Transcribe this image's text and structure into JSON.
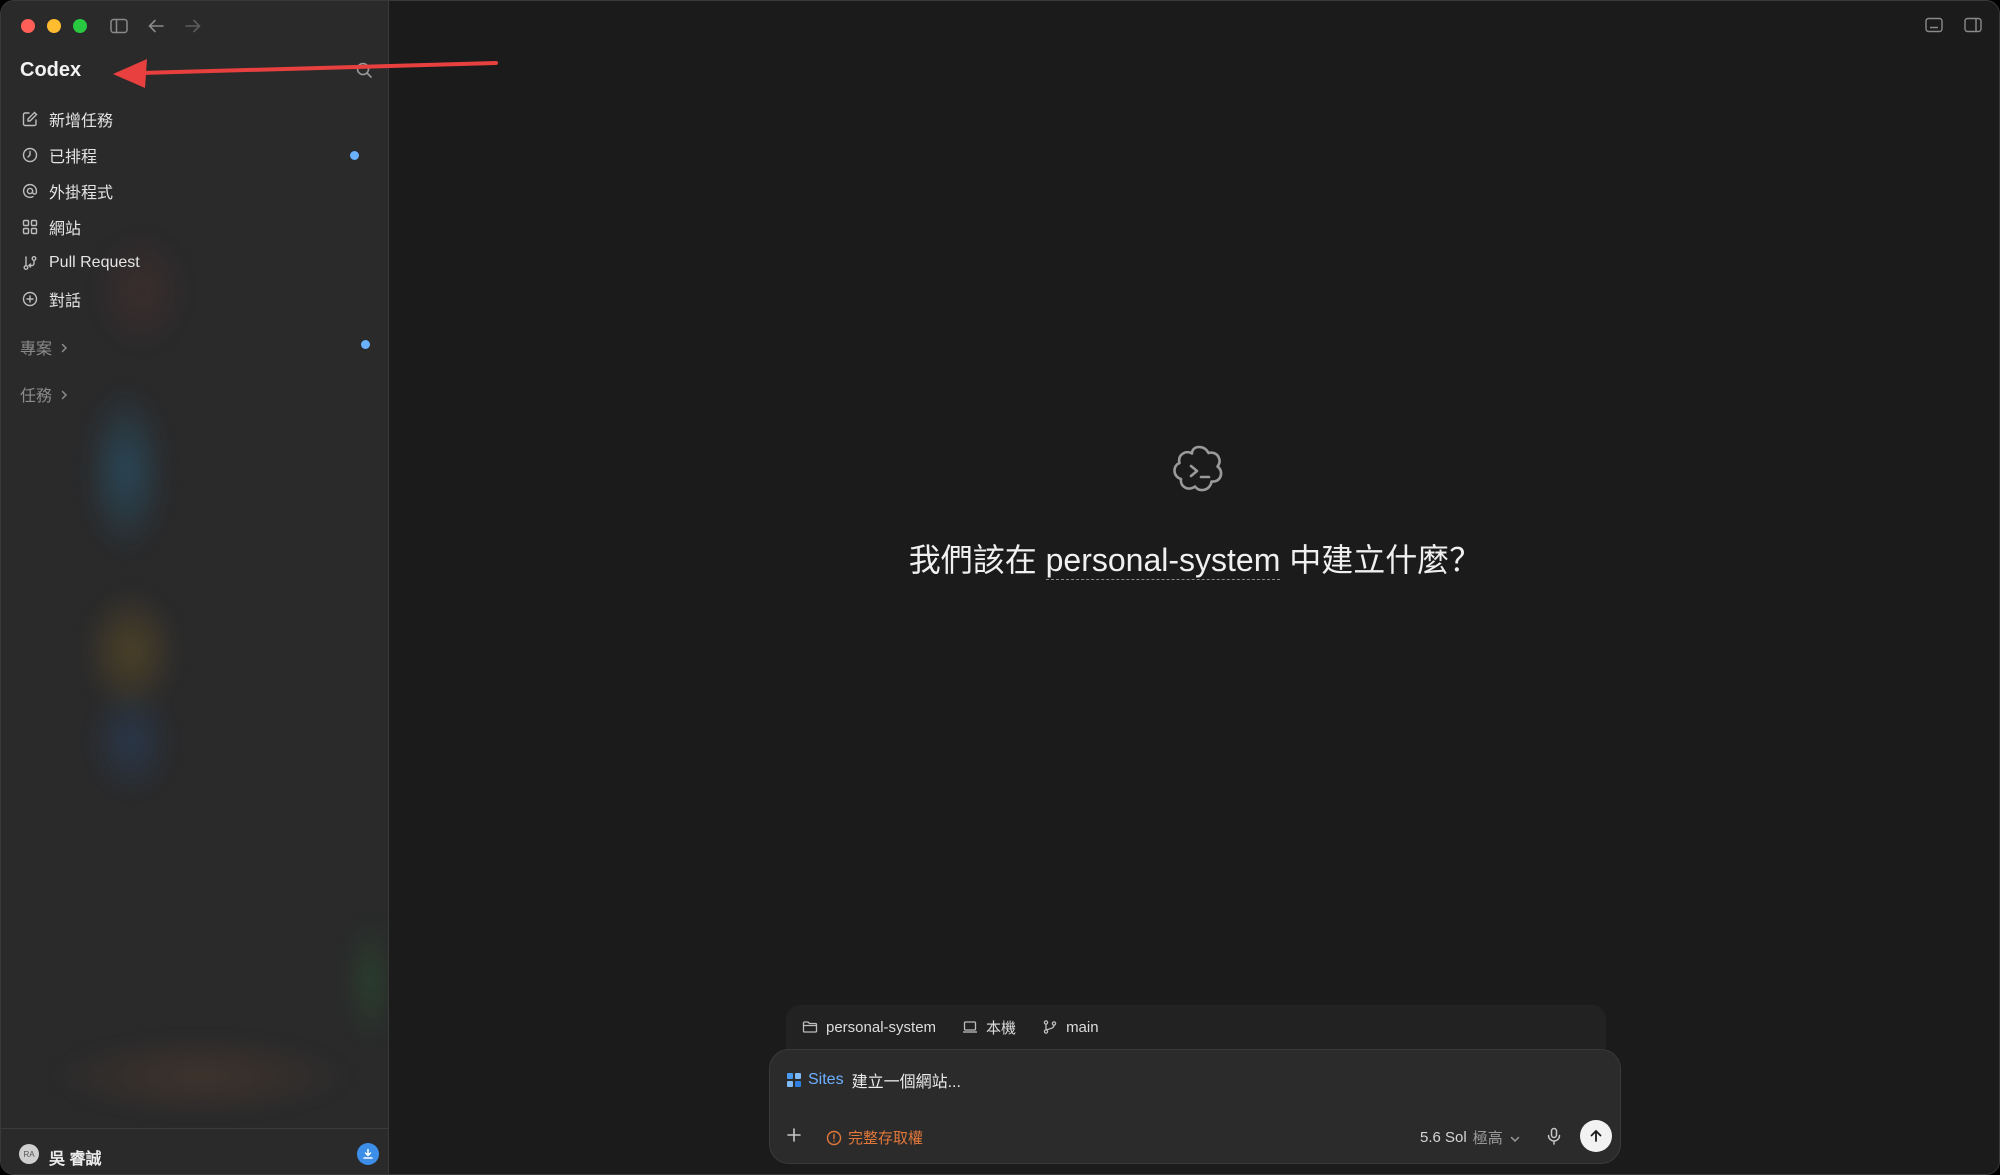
{
  "app": {
    "title": "Codex"
  },
  "sidebar": {
    "items": [
      {
        "label": "新增任務",
        "icon": "edit-icon",
        "badge": false
      },
      {
        "label": "已排程",
        "icon": "clock-icon",
        "badge": true
      },
      {
        "label": "外掛程式",
        "icon": "at-icon",
        "badge": false
      },
      {
        "label": "網站",
        "icon": "grid-icon",
        "badge": false
      },
      {
        "label": "Pull Request",
        "icon": "pull-request-icon",
        "badge": false
      },
      {
        "label": "對話",
        "icon": "chat-plus-icon",
        "badge": false
      }
    ],
    "sections": {
      "projects": "專案",
      "tasks": "任務"
    },
    "user": {
      "name": "吳 睿誠",
      "initials": "RA"
    }
  },
  "main": {
    "hero_prefix": "我們該在 ",
    "hero_project": "personal-system",
    "hero_suffix": " 中建立什麼？"
  },
  "context": {
    "folder": "personal-system",
    "machine": "本機",
    "branch": "main"
  },
  "composer": {
    "tag": "Sites",
    "placeholder": "建立一個網站...",
    "access": "完整存取權",
    "model": "5.6 Sol",
    "level": "極高"
  },
  "colors": {
    "accent_blue": "#6ab1ff",
    "warning_orange": "#e0783a",
    "annotation_red": "#e8403f"
  }
}
